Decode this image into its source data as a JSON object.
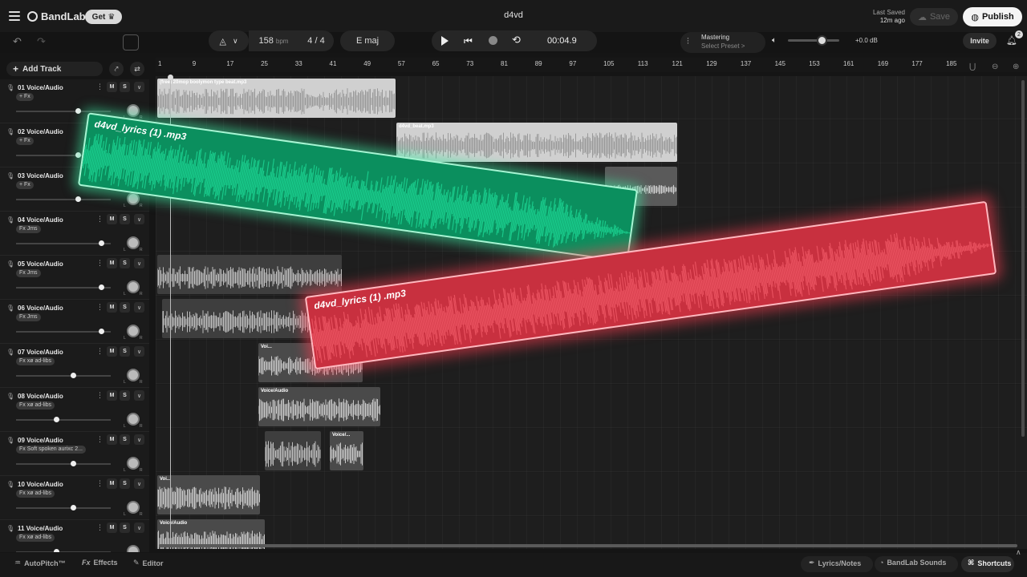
{
  "app": {
    "brand": "BandLab",
    "get_label": "Get",
    "project_title": "d4vd",
    "last_saved_label": "Last Saved",
    "last_saved_value": "12m ago",
    "save_label": "Save",
    "publish_label": "Publish"
  },
  "transport": {
    "bpm_value": "158",
    "bpm_unit": "bpm",
    "time_signature": "4 / 4",
    "key": "E maj",
    "time_display": "00:04.9",
    "mastering_title": "Mastering",
    "mastering_preset": "Select Preset >",
    "volume_db": "+0.0 dB",
    "volume_level": 0.65,
    "invite_label": "Invite",
    "notifications_count": "2"
  },
  "tracklist": {
    "add_track_label": "Add Track",
    "tracks": [
      {
        "name": "01  Voice/Audio",
        "fx": "+ Fx",
        "volume": 0.65
      },
      {
        "name": "02  Voice/Audio",
        "fx": "+ Fx",
        "volume": 0.65
      },
      {
        "name": "03  Voice/Audio",
        "fx": "+ Fx",
        "volume": 0.65
      },
      {
        "name": "04  Voice/Audio",
        "fx": "Fx  Jms",
        "volume": 0.9
      },
      {
        "name": "05  Voice/Audio",
        "fx": "Fx  Jms",
        "volume": 0.9
      },
      {
        "name": "06  Voice/Audio",
        "fx": "Fx  Jms",
        "volume": 0.9
      },
      {
        "name": "07  Voice/Audio",
        "fx": "Fx  xø ad-libs",
        "volume": 0.6
      },
      {
        "name": "08  Voice/Audio",
        "fx": "Fx  xø ad-libs",
        "volume": 0.42
      },
      {
        "name": "09  Voice/Audio",
        "fx": "Fx  Soft spoken aurixc 2...",
        "volume": 0.6
      },
      {
        "name": "10  Voice/Audio",
        "fx": "Fx  xø ad-libs",
        "volume": 0.6
      },
      {
        "name": "11  Voice/Audio",
        "fx": "Fx  xø ad-libs",
        "volume": 0.42
      }
    ],
    "mute_label": "M",
    "solo_label": "S"
  },
  "ruler": {
    "bars": [
      "1",
      "9",
      "17",
      "25",
      "33",
      "41",
      "49",
      "57",
      "65",
      "73",
      "81",
      "89",
      "97",
      "105",
      "113",
      "121",
      "129",
      "137",
      "145",
      "153",
      "161",
      "169",
      "177",
      "185"
    ]
  },
  "clips": {
    "track1": "(free) 20mop boolymon type beat.mp3",
    "track2": "d4vd_beat.mp3",
    "track7": "Voi...",
    "track8": "Voice/Audio",
    "track9": "Voice/...",
    "track10": "Voi...",
    "track11": "Voice/Audio"
  },
  "overlay": {
    "green_clip_label": "d4vd_lyrics (1) .mp3",
    "red_clip_label": "d4vd_lyrics (1) .mp3"
  },
  "bottombar": {
    "autopitch_label": "AutoPitch™",
    "effects_label": "Effects",
    "editor_label": "Editor",
    "lyrics_label": "Lyrics/Notes",
    "sounds_label": "BandLab Sounds",
    "shortcuts_label": "Shortcuts"
  },
  "colors": {
    "green_clip": "#0b8f5e",
    "red_clip": "#c8303f",
    "background": "#151515"
  }
}
